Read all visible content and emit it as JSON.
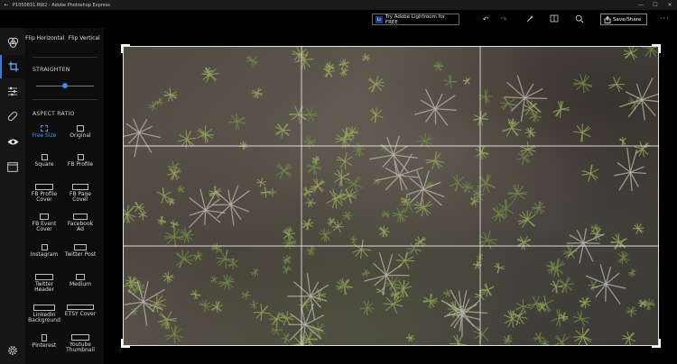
{
  "window": {
    "title": "P1050831.RW2 - Adobe Photoshop Express",
    "controls": [
      "—",
      "☐",
      "✕"
    ]
  },
  "toolbar": {
    "lightroom_label": "Try Adobe Lightroom for FREE",
    "lightroom_badge": "Lr",
    "save_label": "Save/Share",
    "more_label": "···"
  },
  "panel": {
    "flip_horizontal": "Flip Horizontal",
    "flip_vertical": "Flip Vertical",
    "straighten_label": "STRAIGHTEN",
    "straighten_value": 0.5,
    "aspect_ratio_label": "ASPECT RATIO",
    "ratios": [
      {
        "label": "Free Size",
        "active": true
      },
      {
        "label": "Original",
        "active": false
      },
      {
        "label": "Square",
        "active": false
      },
      {
        "label": "FB Profile",
        "active": false
      },
      {
        "label": "FB Profile\nCover",
        "active": false
      },
      {
        "label": "FB Page\nCover",
        "active": false
      },
      {
        "label": "FB Event\nCover",
        "active": false
      },
      {
        "label": "Facebook\nAd",
        "active": false
      },
      {
        "label": "Instagram",
        "active": false
      },
      {
        "label": "Twitter Post",
        "active": false
      },
      {
        "label": "Twitter\nHeader",
        "active": false
      },
      {
        "label": "Medium",
        "active": false
      },
      {
        "label": "LinkedIn\nBackground",
        "active": false
      },
      {
        "label": "ETSY Cover",
        "active": false
      },
      {
        "label": "Pinterest",
        "active": false
      },
      {
        "label": "Youtube\nThumbnail",
        "active": false
      }
    ]
  },
  "colors": {
    "accent": "#4b9df0",
    "panel_bg": "#0d0d0d",
    "rail_bg": "#161616"
  }
}
